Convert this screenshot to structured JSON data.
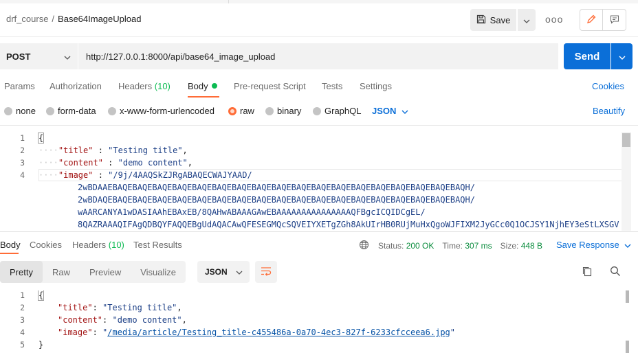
{
  "header": {
    "breadcrumb_parent": "drf_course",
    "breadcrumb_separator": "/",
    "request_name": "Base64ImageUpload",
    "save_label": "Save",
    "more_label": "ooo"
  },
  "request": {
    "method": "POST",
    "url": "http://127.0.0.1:8000/api/base64_image_upload",
    "send_label": "Send"
  },
  "request_tabs": {
    "params": "Params",
    "authorization": "Authorization",
    "headers": "Headers",
    "headers_count": "(10)",
    "body": "Body",
    "pre_request": "Pre-request Script",
    "tests": "Tests",
    "settings": "Settings",
    "cookies": "Cookies"
  },
  "body_types": {
    "none": "none",
    "form_data": "form-data",
    "urlencoded": "x-www-form-urlencoded",
    "raw": "raw",
    "binary": "binary",
    "graphql": "GraphQL",
    "language": "JSON",
    "beautify": "Beautify",
    "selected": "raw"
  },
  "request_body": {
    "line_numbers": [
      "1",
      "2",
      "3",
      "4"
    ],
    "open_brace": "{",
    "title_key": "\"title\"",
    "title_value": "\"Testing title\"",
    "content_key": "\"content\"",
    "content_value": "\"demo content\"",
    "image_key": "\"image\"",
    "image_lines": [
      "\"/9j/4AAQSkZJRgABAQECWAJYAAD/",
      "2wBDAAEBAQEBAQEBAQEBAQEBAQEBAQEBAQEBAQEBAQEBAQEBAQEBAQEBAQEBAQEBAQEBAQEBAQEBAQH/",
      "2wBDAQEBAQEBAQEBAQEBAQEBAQEBAQEBAQEBAQEBAQEBAQEBAQEBAQEBAQEBAQEBAQEBAQEBAQEBAQH/",
      "wAARCANYA1wDASIAAhEBAxEB/8QAHwABAAAGAwEBAAAAAAAAAAAAAAAQFBgcICQIDCgEL/",
      "8QAZRAAAQIFAgQDBQYFAQQEBgUdAQACAwQFESEGMQcSQVEIYXETgZGh8AkUIrHB0RUjMuHxQgoWJFIXM2JyGCc0Q1OCJSY1NjhEY3eStLXSGV"
    ]
  },
  "response_tabs": {
    "body": "Body",
    "cookies": "Cookies",
    "headers": "Headers",
    "headers_count": "(10)",
    "test_results": "Test Results"
  },
  "response_status": {
    "status_label": "Status:",
    "status_value": "200 OK",
    "time_label": "Time:",
    "time_value": "307 ms",
    "size_label": "Size:",
    "size_value": "448 B",
    "save_response": "Save Response"
  },
  "response_view": {
    "pretty": "Pretty",
    "raw": "Raw",
    "preview": "Preview",
    "visualize": "Visualize",
    "format": "JSON"
  },
  "response_body": {
    "line_numbers": [
      "1",
      "2",
      "3",
      "4",
      "5"
    ],
    "open_brace": "{",
    "close_brace": "}",
    "title_key": "\"title\"",
    "title_value": "\"Testing title\"",
    "content_key": "\"content\"",
    "content_value": "\"demo content\"",
    "image_key": "\"image\"",
    "image_value": "/media/article/Testing_title-c455486a-0a70-4ec3-827f-6233cfcceea6.jpg"
  },
  "colors": {
    "accent_orange": "#ff6c37",
    "send_blue": "#0b6fd8",
    "status_green": "#0cbb52"
  }
}
